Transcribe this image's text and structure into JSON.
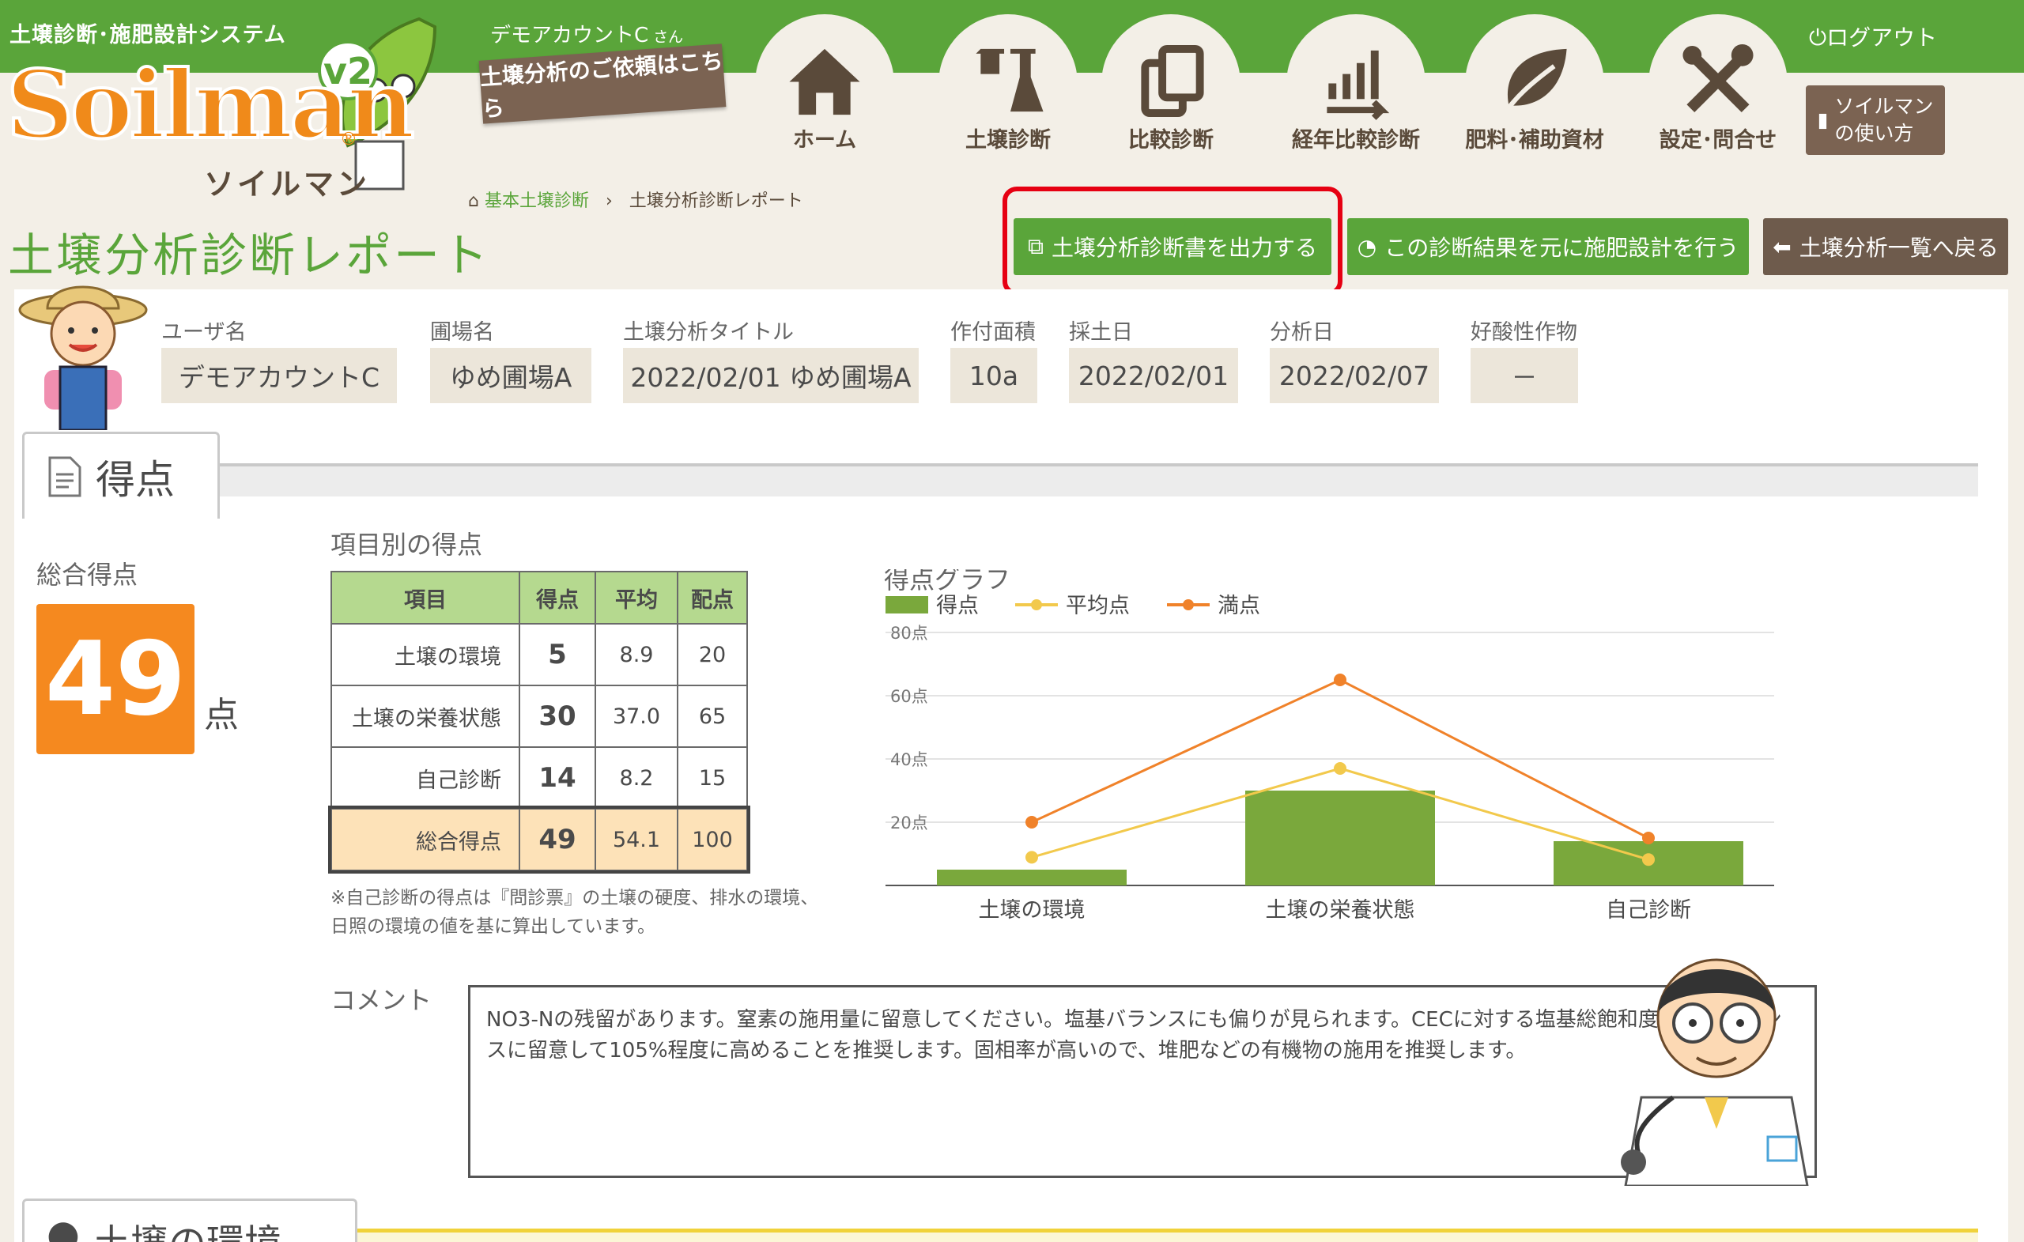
{
  "header": {
    "system_title": "土壌診断･施肥設計システム",
    "account_name": "デモアカウントC",
    "account_suffix": "さん",
    "request_button": "土壌分析のご依頼はこちら",
    "logo_text": "Soilman",
    "logo_reg": "®",
    "logo_kana": "ソイルマン",
    "version": "v2",
    "logout": "ログアウト",
    "manual_line1": "ソイルマン",
    "manual_line2": "の使い方",
    "nav": [
      {
        "label": "ホーム",
        "icon": "home-icon"
      },
      {
        "label": "土壌診断",
        "icon": "flask-icon"
      },
      {
        "label": "比較診断",
        "icon": "copy-icon"
      },
      {
        "label": "経年比較診断",
        "icon": "trend-chart-icon"
      },
      {
        "label": "肥料･補助資材",
        "icon": "leaf-icon"
      },
      {
        "label": "設定･問合せ",
        "icon": "tools-icon"
      }
    ]
  },
  "breadcrumb": {
    "home": "基本土壌診断",
    "separator": "›",
    "current": "土壌分析診断レポート"
  },
  "page_title": "土壌分析診断レポート",
  "actions": {
    "export": "土壌分析診断書を出力する",
    "design": "この診断結果を元に施肥設計を行う",
    "back": "土壌分析一覧へ戻る"
  },
  "info": {
    "fields": [
      {
        "label": "ユーザ名",
        "value": "デモアカウントC"
      },
      {
        "label": "圃場名",
        "value": "ゆめ圃場A"
      },
      {
        "label": "土壌分析タイトル",
        "value": "2022/02/01 ゆめ圃場A"
      },
      {
        "label": "作付面積",
        "value": "10a"
      },
      {
        "label": "採土日",
        "value": "2022/02/01"
      },
      {
        "label": "分析日",
        "value": "2022/02/07"
      },
      {
        "label": "好酸性作物",
        "value": "－"
      }
    ]
  },
  "tab_score": "得点",
  "score": {
    "total_label": "総合得点",
    "total_value": "49",
    "unit": "点",
    "table_title": "項目別の得点",
    "headers": [
      "項目",
      "得点",
      "平均",
      "配点"
    ],
    "rows": [
      {
        "item": "土壌の環境",
        "score": "5",
        "avg": "8.9",
        "max": "20"
      },
      {
        "item": "土壌の栄養状態",
        "score": "30",
        "avg": "37.0",
        "max": "65"
      },
      {
        "item": "自己診断",
        "score": "14",
        "avg": "8.2",
        "max": "15"
      }
    ],
    "total_row": {
      "item": "総合得点",
      "score": "49",
      "avg": "54.1",
      "max": "100"
    },
    "note_line1": "※自己診断の得点は『問診票』の土壌の硬度、排水の環境、",
    "note_line2": "日照の環境の値を基に算出しています。"
  },
  "chart_data": {
    "type": "bar",
    "title": "得点グラフ",
    "categories": [
      "土壌の環境",
      "土壌の栄養状態",
      "自己診断"
    ],
    "series": [
      {
        "name": "得点",
        "kind": "bar",
        "color": "#7aa83c",
        "values": [
          5,
          30,
          14
        ]
      },
      {
        "name": "平均点",
        "kind": "line",
        "color": "#f2c94c",
        "values": [
          8.9,
          37.0,
          8.2
        ]
      },
      {
        "name": "満点",
        "kind": "line",
        "color": "#f0822a",
        "values": [
          20,
          65,
          15
        ]
      }
    ],
    "yticks": [
      "80点",
      "60点",
      "40点",
      "20点"
    ],
    "ytick_values": [
      80,
      60,
      40,
      20
    ],
    "ylim": [
      0,
      80
    ],
    "grid": true,
    "legend": "top-left"
  },
  "comment": {
    "label": "コメント",
    "text": "NO3-Nの残留があります。窒素の施用量に留意してください。塩基バランスにも偏りが見られます。CECに対する塩基総飽和度を塩基バランスに留意して105%程度に高めることを推奨します。固相率が高いので、堆肥などの有機物の施用を推奨します。"
  },
  "tab_env": "土壌の環境",
  "colors": {
    "brand_green": "#5aa53a",
    "accent_orange": "#f5891f",
    "brown": "#7b6352",
    "highlight_red": "#e60012"
  }
}
